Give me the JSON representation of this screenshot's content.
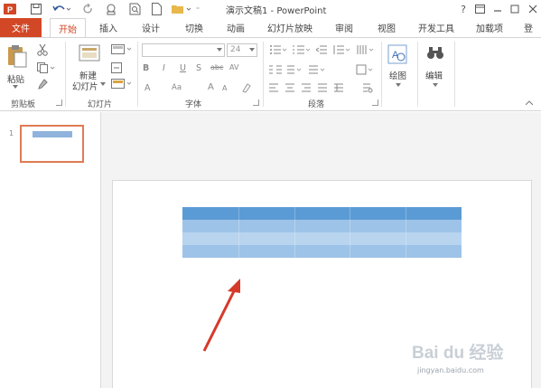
{
  "window": {
    "title": "演示文稿1 - PowerPoint",
    "help_label": "?",
    "controls": [
      "restore-icon",
      "minimize-icon",
      "maximize-icon",
      "close-icon"
    ]
  },
  "quick_access": [
    "powerpoint-logo-icon",
    "save-icon",
    "undo-icon",
    "redo-icon",
    "repeat-icon",
    "print-preview-icon",
    "new-icon",
    "open-folder-icon",
    "customize-icon"
  ],
  "tabs": {
    "file": "文件",
    "items": [
      "开始",
      "插入",
      "设计",
      "切换",
      "动画",
      "幻灯片放映",
      "审阅",
      "视图",
      "开发工具",
      "加载项",
      "登"
    ],
    "active_index": 0
  },
  "ribbon": {
    "clipboard": {
      "paste_label": "粘贴",
      "group_label": "剪贴板"
    },
    "slides": {
      "new_slide_label_1": "新建",
      "new_slide_label_2": "幻灯片",
      "group_label": "幻灯片"
    },
    "font": {
      "font_size": "24",
      "group_label": "字体",
      "buttons": [
        "B",
        "I",
        "U",
        "S",
        "abc",
        "AV",
        "A",
        "Aa",
        "A",
        "A"
      ]
    },
    "paragraph": {
      "group_label": "段落"
    },
    "drawing": {
      "label": "绘图"
    },
    "editing": {
      "label": "编辑"
    }
  },
  "thumbnails": {
    "slide_number": "1"
  },
  "table": {
    "rows": 4,
    "cols": 5,
    "header_color": "#5b9bd5",
    "row_colors": [
      "#5b9bd5",
      "#9ec3e8",
      "#b8d4ef",
      "#9ec3e8"
    ]
  },
  "watermark": {
    "logo": "Bai du 经验",
    "url": "jingyan.baidu.com"
  },
  "colors": {
    "accent": "#d24726",
    "arrow": "#d63a2a"
  }
}
